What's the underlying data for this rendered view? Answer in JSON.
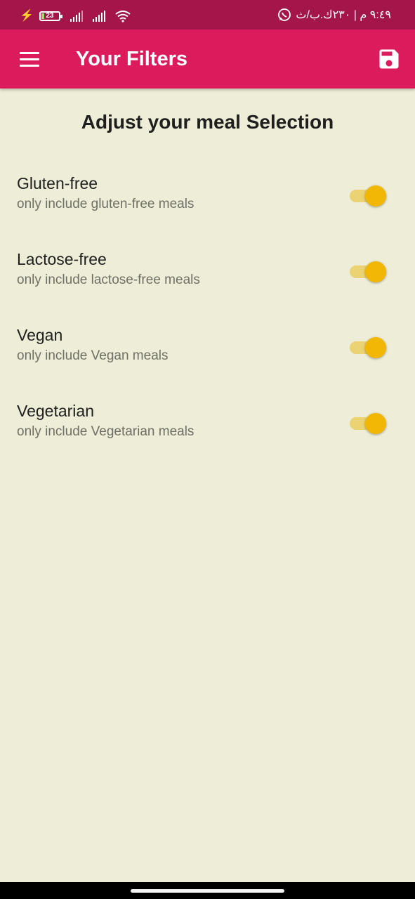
{
  "status_bar": {
    "battery_level": "23",
    "time_text": "٩:٤٩ م | ٢٣٠ك.ب/ث"
  },
  "app_bar": {
    "title": "Your Filters",
    "color": "#dc1b5d",
    "menu_icon": "menu-icon",
    "save_icon": "save-icon"
  },
  "page": {
    "heading": "Adjust your meal Selection",
    "background": "#eeedd7"
  },
  "filters": [
    {
      "title": "Gluten-free",
      "subtitle": "only include gluten-free meals",
      "enabled": true
    },
    {
      "title": "Lactose-free",
      "subtitle": "only include lactose-free meals",
      "enabled": true
    },
    {
      "title": "Vegan",
      "subtitle": "only include Vegan meals",
      "enabled": true
    },
    {
      "title": "Vegetarian",
      "subtitle": "only include Vegetarian meals",
      "enabled": true
    }
  ],
  "switch_colors": {
    "thumb": "#f2b705",
    "track": "#ebd374"
  }
}
